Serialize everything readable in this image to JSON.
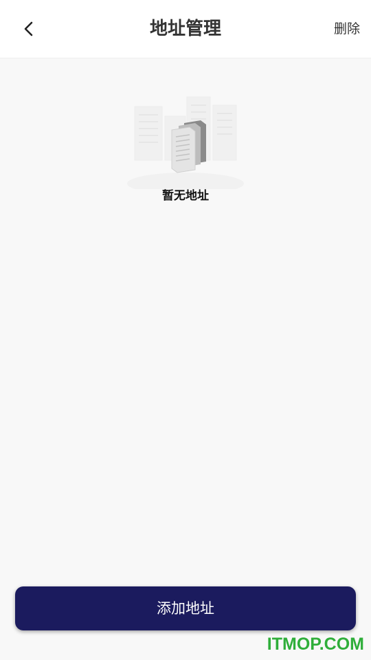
{
  "header": {
    "title": "地址管理",
    "action_label": "删除",
    "back_icon": "chevron-left-icon"
  },
  "empty_state": {
    "message": "暂无地址",
    "illustration": "empty-documents-illustration"
  },
  "footer": {
    "add_label": "添加地址",
    "button_color": "#1b1b5e"
  },
  "watermark": "ITMOP.COM"
}
